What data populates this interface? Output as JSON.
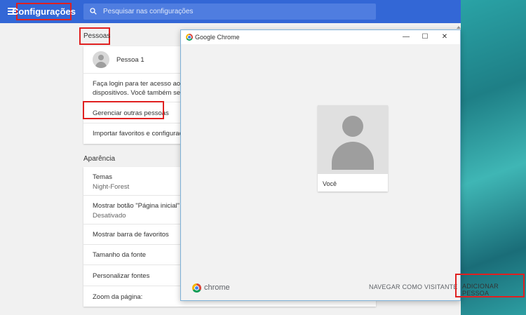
{
  "header": {
    "title": "Configurações",
    "search_placeholder": "Pesquisar nas configurações"
  },
  "people_section": {
    "label": "Pessoas",
    "profile_name": "Pessoa 1",
    "signin_line1": "Faça login para ter acesso aos favo",
    "signin_line2": "dispositivos. Você também será co",
    "manage_people": "Gerenciar outras pessoas",
    "import": "Importar favoritos e configurações"
  },
  "appearance_section": {
    "label": "Aparência",
    "themes_label": "Temas",
    "themes_value": "Night-Forest",
    "home_button_label": "Mostrar botão \"Página inicial\"",
    "home_button_value": "Desativado",
    "bookmarks_bar": "Mostrar barra de favoritos",
    "font_size": "Tamanho da fonte",
    "customize_fonts": "Personalizar fontes",
    "page_zoom": "Zoom da página:"
  },
  "dialog": {
    "title": "Google Chrome",
    "minimize": "—",
    "maximize": "☐",
    "close": "✕",
    "profile_card_name": "Você",
    "brand": "chrome",
    "browse_as_guest": "NAVEGAR COMO VISITANTE",
    "add_person": "ADICIONAR PESSOA"
  },
  "colors": {
    "header_bg": "#3367d6",
    "highlight_border": "#e02020"
  }
}
